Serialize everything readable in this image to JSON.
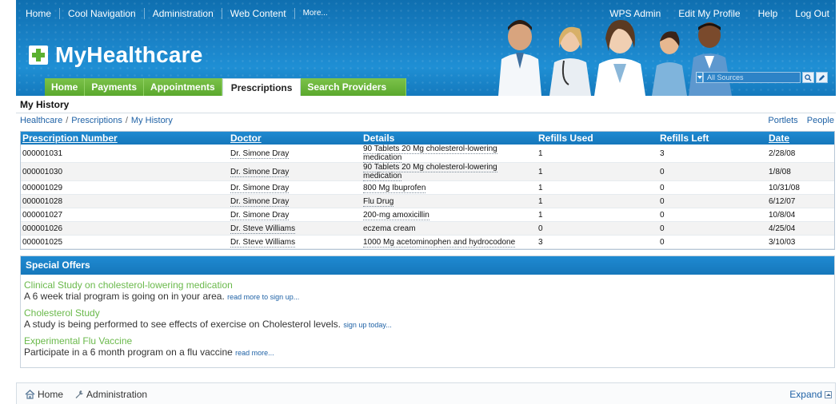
{
  "header": {
    "top_nav": [
      "Home",
      "Cool Navigation",
      "Administration",
      "Web Content",
      "More..."
    ],
    "user_nav": [
      "WPS Admin",
      "Edit My Profile",
      "Help",
      "Log Out"
    ],
    "brand": "MyHealthcare",
    "search": {
      "scope": "All Sources",
      "placeholder": ""
    },
    "tabs": [
      {
        "label": "Home",
        "active": false
      },
      {
        "label": "Payments",
        "active": false
      },
      {
        "label": "Appointments",
        "active": false
      },
      {
        "label": "Prescriptions",
        "active": true
      },
      {
        "label": "Search Providers",
        "active": false
      }
    ]
  },
  "page": {
    "title": "My History",
    "breadcrumb": [
      "Healthcare",
      "Prescriptions",
      "My History"
    ],
    "portal_links": [
      "Portlets",
      "People"
    ]
  },
  "history": {
    "columns": [
      "Prescription Number",
      "Doctor",
      "Details",
      "Refills Used",
      "Refills Left",
      "Date"
    ],
    "rows": [
      [
        "000001031",
        "Dr. Simone Dray",
        "90 Tablets 20 Mg cholesterol-lowering medication",
        "1",
        "3",
        "2/28/08"
      ],
      [
        "000001030",
        "Dr. Simone Dray",
        "90 Tablets 20 Mg cholesterol-lowering medication",
        "1",
        "0",
        "1/8/08"
      ],
      [
        "000001029",
        "Dr. Simone Dray",
        "800 Mg Ibuprofen",
        "1",
        "0",
        "10/31/08"
      ],
      [
        "000001028",
        "Dr. Simone Dray",
        "Flu Drug",
        "1",
        "0",
        "6/12/07"
      ],
      [
        "000001027",
        "Dr. Simone Dray",
        "200-mg amoxicillin",
        "1",
        "0",
        "10/8/04"
      ],
      [
        "000001026",
        "Dr. Steve Williams",
        "eczema cream",
        "0",
        "0",
        "4/25/04"
      ],
      [
        "000001025",
        "Dr. Steve Williams",
        "1000 Mg acetominophen and hydrocodone",
        "3",
        "0",
        "3/10/03"
      ]
    ]
  },
  "offers": {
    "title": "Special Offers",
    "items": [
      {
        "title": "Clinical Study on cholesterol-lowering medication",
        "text": "A 6 week trial program is going on in your area.",
        "link": "read more to sign up..."
      },
      {
        "title": "Cholesterol Study",
        "text": "A study is being performed to see effects of exercise on Cholesterol levels.",
        "link": "sign up today..."
      },
      {
        "title": "Experimental Flu Vaccine",
        "text": "Participate in a 6 month program on a flu vaccine",
        "link": "read more..."
      }
    ]
  },
  "footer": {
    "links": [
      {
        "label": "Home",
        "icon": "house-icon"
      },
      {
        "label": "Administration",
        "icon": "wrench-icon"
      }
    ],
    "expand": "Expand"
  },
  "colors": {
    "banner": "#1a83c8",
    "tab_green": "#5aa82d",
    "header_blue": "#1677bb",
    "offer_green": "#6ab94b",
    "link": "#1f62a6"
  }
}
